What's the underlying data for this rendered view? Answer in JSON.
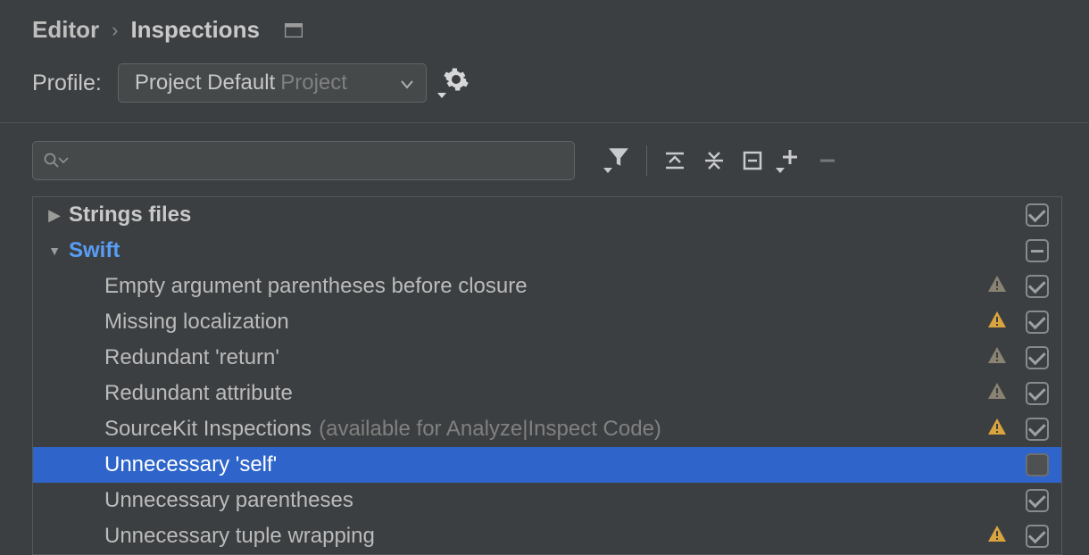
{
  "breadcrumb": {
    "root": "Editor",
    "current": "Inspections"
  },
  "profile": {
    "label": "Profile:",
    "name": "Project Default",
    "scope": "Project"
  },
  "search": {
    "placeholder": ""
  },
  "tree": {
    "groups": [
      {
        "id": "strings-files",
        "expanded": false,
        "label": "Strings files",
        "state": "checked"
      },
      {
        "id": "swift",
        "expanded": true,
        "label": "Swift",
        "link": true,
        "state": "indeterminate",
        "children": [
          {
            "id": "empty-arg-paren",
            "label": "Empty argument parentheses before closure",
            "warn": "weak",
            "state": "checked"
          },
          {
            "id": "missing-localization",
            "label": "Missing localization",
            "warn": "warning",
            "state": "checked"
          },
          {
            "id": "redundant-return",
            "label": "Redundant 'return'",
            "warn": "weak",
            "state": "checked"
          },
          {
            "id": "redundant-attribute",
            "label": "Redundant attribute",
            "warn": "weak",
            "state": "checked"
          },
          {
            "id": "sourcekit",
            "label": "SourceKit Inspections",
            "suffix": "(available for Analyze|Inspect Code)",
            "warn": "warning",
            "state": "checked"
          },
          {
            "id": "unnecessary-self",
            "label": "Unnecessary 'self'",
            "warn": "none",
            "state": "unchecked",
            "selected": true
          },
          {
            "id": "unnecessary-paren",
            "label": "Unnecessary parentheses",
            "warn": "none",
            "state": "checked"
          },
          {
            "id": "unnecessary-tuple",
            "label": "Unnecessary tuple wrapping",
            "warn": "warning",
            "state": "checked"
          }
        ]
      }
    ]
  },
  "icons": {
    "warn_weak_color": "#8a8374",
    "warn_warning_color": "#d9a33e"
  }
}
